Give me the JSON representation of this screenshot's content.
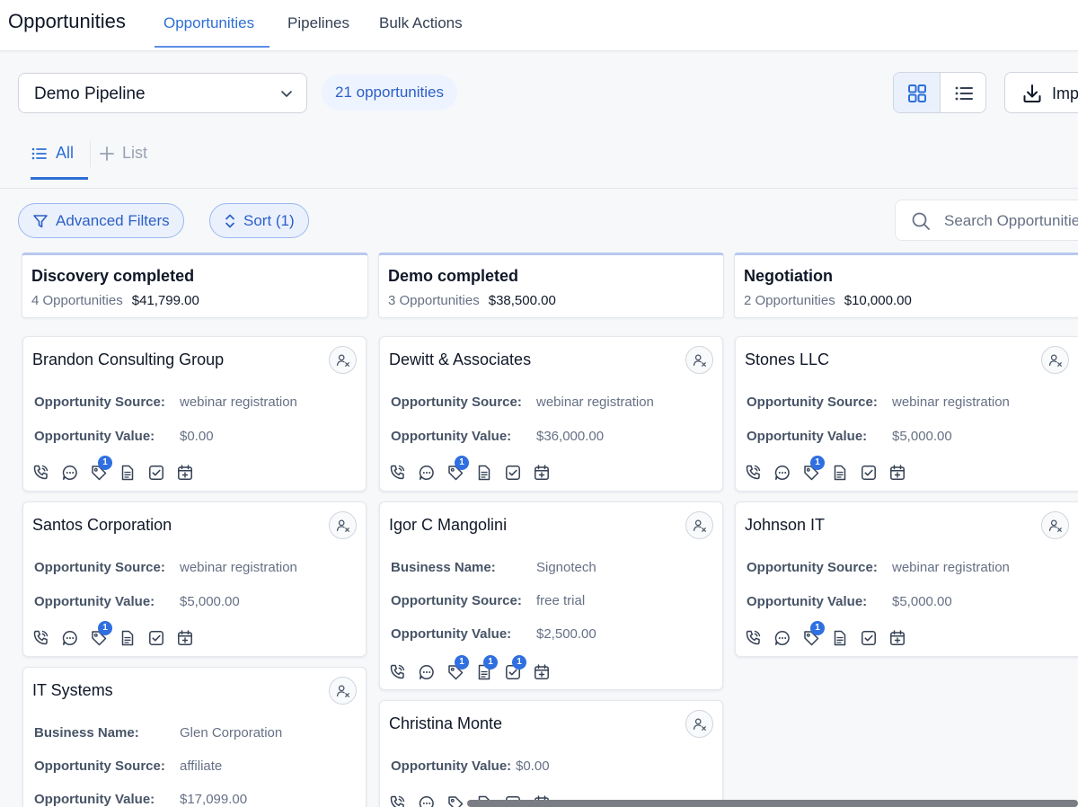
{
  "app": {
    "title": "Opportunities"
  },
  "top_tabs": [
    {
      "label": "Opportunities"
    },
    {
      "label": "Pipelines"
    },
    {
      "label": "Bulk Actions"
    }
  ],
  "pipeline": {
    "selected": "Demo Pipeline",
    "count_label": "21 opportunities"
  },
  "toolbar": {
    "import_label": "Imp"
  },
  "smart_lists": {
    "all_label": "All",
    "add_list_label": "List"
  },
  "filters": {
    "advanced_label": "Advanced Filters",
    "sort_label": "Sort (1)"
  },
  "search": {
    "placeholder": "Search Opportunities"
  },
  "colors": {
    "accent": "#2e6fd6",
    "badge": "#2f6fe0",
    "stage_border": "#b9c7f0"
  },
  "stages": [
    {
      "name": "Discovery completed",
      "count": "4 Opportunities",
      "value": "$41,799.00",
      "cards": [
        {
          "name": "Brandon Consulting Group",
          "fields": [
            {
              "label": "Opportunity Source:",
              "value": "webinar registration"
            },
            {
              "label": "Opportunity Value:",
              "value": "$0.00"
            }
          ]
        },
        {
          "name": "Santos Corporation",
          "fields": [
            {
              "label": "Opportunity Source:",
              "value": "webinar registration"
            },
            {
              "label": "Opportunity Value:",
              "value": "$5,000.00"
            }
          ]
        },
        {
          "name": "IT Systems",
          "fields": [
            {
              "label": "Business Name:",
              "value": "Glen Corporation"
            },
            {
              "label": "Opportunity Source:",
              "value": "affiliate"
            },
            {
              "label": "Opportunity Value:",
              "value": "$17,099.00"
            }
          ]
        }
      ]
    },
    {
      "name": "Demo completed",
      "count": "3 Opportunities",
      "value": "$38,500.00",
      "cards": [
        {
          "name": "Dewitt & Associates",
          "fields": [
            {
              "label": "Opportunity Source:",
              "value": "webinar registration"
            },
            {
              "label": "Opportunity Value:",
              "value": "$36,000.00"
            }
          ]
        },
        {
          "name": "Igor C Mangolini",
          "fields": [
            {
              "label": "Business Name:",
              "value": "Signotech"
            },
            {
              "label": "Opportunity Source:",
              "value": "free trial"
            },
            {
              "label": "Opportunity Value:",
              "value": "$2,500.00"
            }
          ]
        },
        {
          "name": "Christina Monte",
          "fields": [
            {
              "label": "Opportunity Value:",
              "value": "$0.00"
            }
          ]
        }
      ]
    },
    {
      "name": "Negotiation",
      "count": "2 Opportunities",
      "value": "$10,000.00",
      "cards": [
        {
          "name": "Stones LLC",
          "fields": [
            {
              "label": "Opportunity Source:",
              "value": "webinar registration"
            },
            {
              "label": "Opportunity Value:",
              "value": "$5,000.00"
            }
          ]
        },
        {
          "name": "Johnson IT",
          "fields": [
            {
              "label": "Opportunity Source:",
              "value": "webinar registration"
            },
            {
              "label": "Opportunity Value:",
              "value": "$5,000.00"
            }
          ]
        }
      ]
    }
  ],
  "card_actions": [
    "phone-icon",
    "chat-icon",
    "tag-icon",
    "notes-icon",
    "task-icon",
    "appointment-icon"
  ],
  "badge_count": "1"
}
